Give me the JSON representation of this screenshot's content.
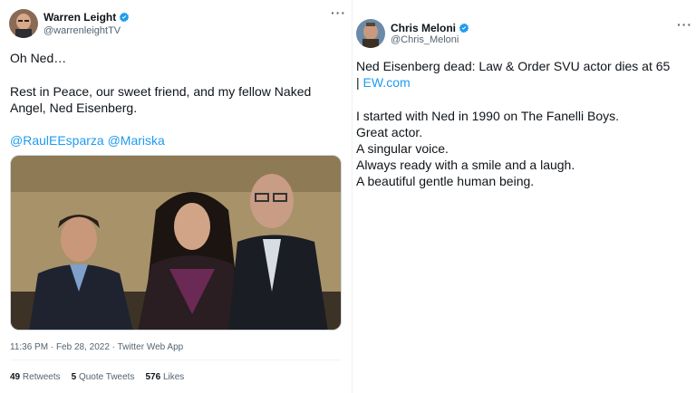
{
  "left_tweet": {
    "name": "Warren Leight",
    "handle": "@warrenleightTV",
    "line1": "Oh Ned…",
    "line2": "Rest in Peace, our sweet friend, and my fellow Naked",
    "line3": "Angel, Ned Eisenberg.",
    "mention1": "@RaulEEsparza",
    "mention2": "@Mariska",
    "time": "11:36 PM · Feb 28, 2022 · Twitter Web App",
    "retweets_count": "49",
    "retweets_label": "Retweets",
    "quotes_count": "5",
    "quotes_label": "Quote Tweets",
    "likes_count": "576",
    "likes_label": "Likes"
  },
  "right_tweet": {
    "name": "Chris Meloni",
    "handle": "@Chris_Meloni",
    "line1": "Ned Eisenberg dead: Law & Order SVU actor dies at 65",
    "line2_prefix": "| ",
    "line2_link": "EW.com",
    "line3": "I started with Ned in 1990 on The Fanelli Boys.",
    "line4": "Great actor.",
    "line5": "A singular voice.",
    "line6": "Always ready with a smile and a laugh.",
    "line7": "A beautiful gentle human being."
  },
  "more_glyph": "···",
  "colors": {
    "link": "#1d9bf0",
    "secondary": "#536471",
    "text": "#0f1419"
  }
}
